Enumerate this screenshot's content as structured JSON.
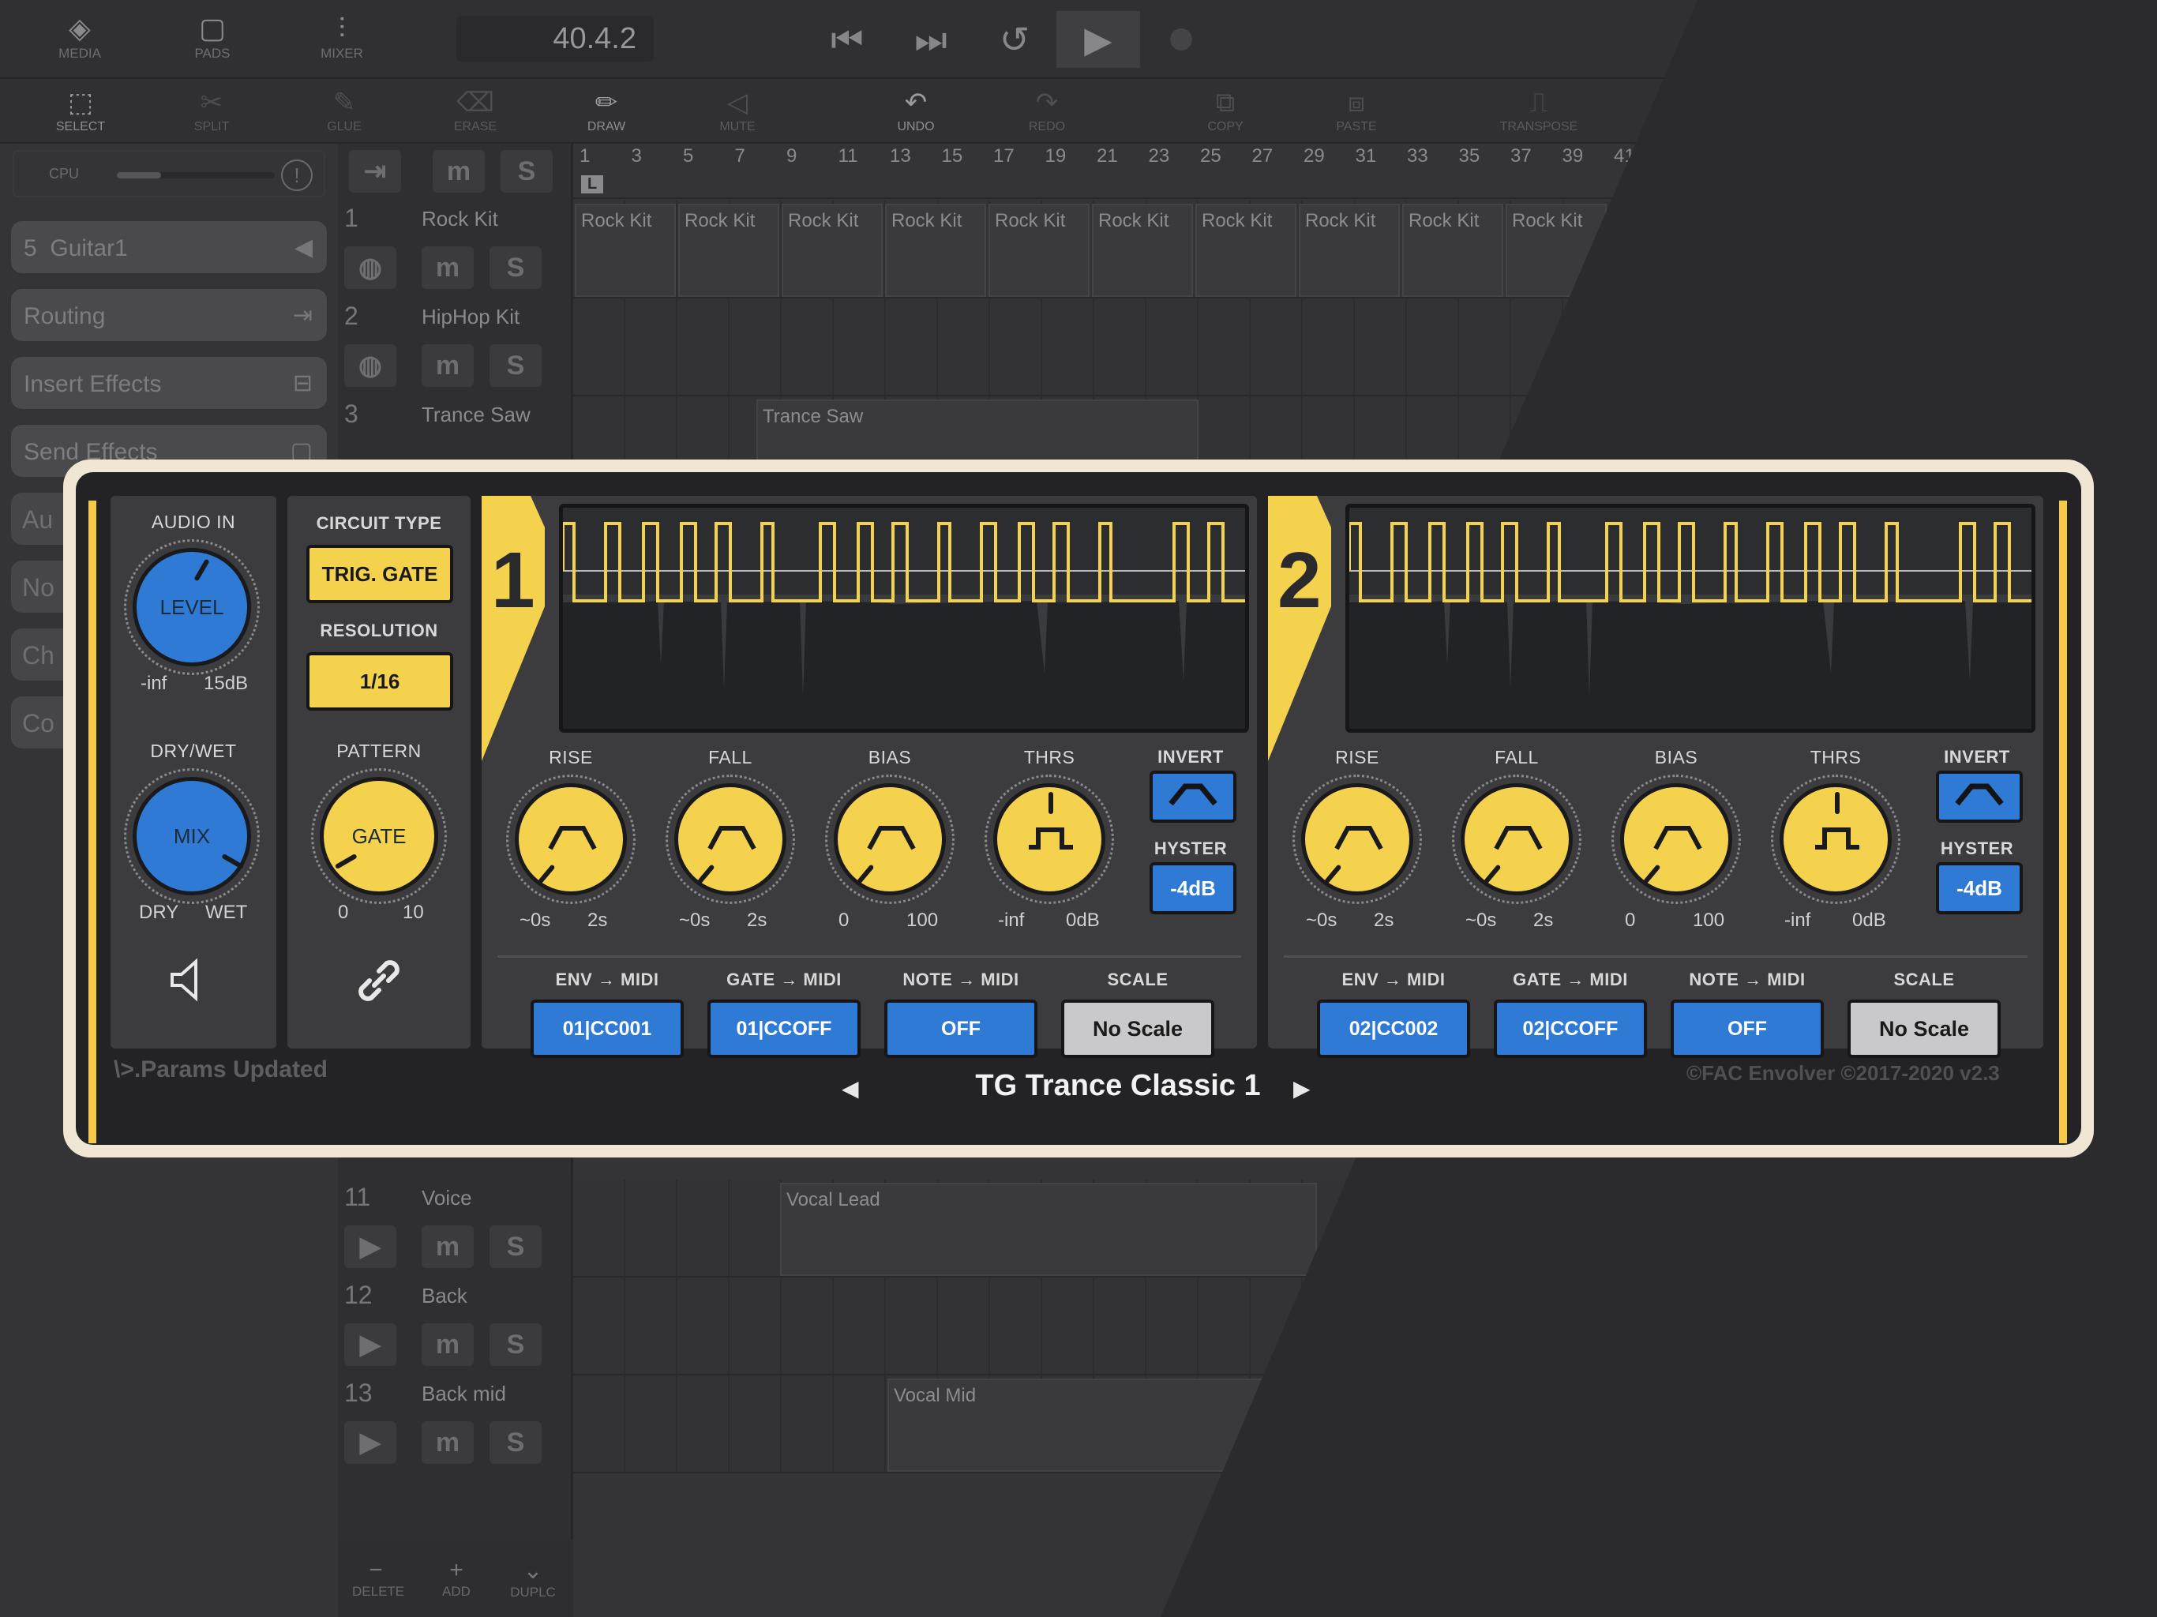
{
  "toolbar": {
    "media": "MEDIA",
    "pads": "PADS",
    "mixer": "MIXER",
    "position": "40.4.2"
  },
  "tools": [
    {
      "label": "SELECT"
    },
    {
      "label": "SPLIT"
    },
    {
      "label": "GLUE"
    },
    {
      "label": "ERASE"
    },
    {
      "label": "DRAW"
    },
    {
      "label": "MUTE"
    },
    {
      "label": "UNDO"
    },
    {
      "label": "REDO"
    },
    {
      "label": "COPY"
    },
    {
      "label": "PASTE"
    },
    {
      "label": "TRANSPOSE"
    }
  ],
  "cpu_label": "CPU",
  "cpu_load": 0.28,
  "sidebar": {
    "track_number": "5",
    "track_name": "Guitar1",
    "routing": "Routing",
    "insert_effects": "Insert Effects",
    "send_effects": "Send Effects",
    "cut_items": [
      "Au",
      "No",
      "Ch",
      "Co"
    ]
  },
  "ruler_ticks": [
    "1",
    "3",
    "5",
    "7",
    "9",
    "11",
    "13",
    "15",
    "17",
    "19",
    "21",
    "23",
    "25",
    "27",
    "29",
    "31",
    "33",
    "35",
    "37",
    "39",
    "41"
  ],
  "ruler_loop_marker": "L",
  "tracks_top": [
    {
      "num": "1",
      "name": "Rock Kit",
      "clip": "Rock Kit"
    },
    {
      "num": "2",
      "name": "HipHop Kit",
      "clip": ""
    },
    {
      "num": "3",
      "name": "Trance Saw",
      "clip": "Trance Saw"
    }
  ],
  "tracks_bottom": [
    {
      "num": "11",
      "name": "Voice",
      "clip": "Vocal Lead"
    },
    {
      "num": "12",
      "name": "Back",
      "clip": ""
    },
    {
      "num": "13",
      "name": "Back mid",
      "clip": "Vocal Mid"
    }
  ],
  "track_buttons": {
    "mute": "m",
    "solo": "S"
  },
  "bottom": {
    "delete": "DELETE",
    "add": "ADD",
    "duplicate": "DUPLC"
  },
  "plugin": {
    "audio_in": "AUDIO IN",
    "level_knob": "LEVEL",
    "level_min": "-inf",
    "level_max": "15dB",
    "drywet": "DRY/WET",
    "mix_knob": "MIX",
    "dry": "DRY",
    "wet": "WET",
    "circuit_type_label": "CIRCUIT TYPE",
    "circuit_type": "TRIG. GATE",
    "resolution_label": "RESOLUTION",
    "resolution": "1/16",
    "pattern_label": "PATTERN",
    "pattern_knob": "GATE",
    "pattern_min": "0",
    "pattern_max": "10",
    "status": "\\>.Params Updated",
    "preset": "TG Trance Classic 1",
    "copyright": "©FAC Envolver ©2017-2020 v2.3",
    "channels": [
      {
        "num": "1",
        "rise": "RISE",
        "rise_min": "~0s",
        "rise_max": "2s",
        "fall": "FALL",
        "fall_min": "~0s",
        "fall_max": "2s",
        "bias": "BIAS",
        "bias_min": "0",
        "bias_max": "100",
        "thrs": "THRS",
        "thrs_min": "-inf",
        "thrs_max": "0dB",
        "invert": "INVERT",
        "hyster": "HYSTER",
        "hyster_value": "-4dB",
        "env_midi_label": "ENV → MIDI",
        "env_midi": "01|CC001",
        "gate_midi_label": "GATE → MIDI",
        "gate_midi": "01|CCOFF",
        "note_midi_label": "NOTE → MIDI",
        "note_midi": "OFF",
        "scale_label": "SCALE",
        "scale": "No Scale"
      },
      {
        "num": "2",
        "rise": "RISE",
        "rise_min": "~0s",
        "rise_max": "2s",
        "fall": "FALL",
        "fall_min": "~0s",
        "fall_max": "2s",
        "bias": "BIAS",
        "bias_min": "0",
        "bias_max": "100",
        "thrs": "THRS",
        "thrs_min": "-inf",
        "thrs_max": "0dB",
        "invert": "INVERT",
        "hyster": "HYSTER",
        "hyster_value": "-4dB",
        "env_midi_label": "ENV → MIDI",
        "env_midi": "02|CC002",
        "gate_midi_label": "GATE → MIDI",
        "gate_midi": "02|CCOFF",
        "note_midi_label": "NOTE → MIDI",
        "note_midi": "OFF",
        "scale_label": "SCALE",
        "scale": "No Scale"
      }
    ]
  },
  "colors": {
    "accent_yellow": "#f4d24e",
    "accent_blue": "#2f7ad5",
    "frame": "#f1e6d4"
  }
}
